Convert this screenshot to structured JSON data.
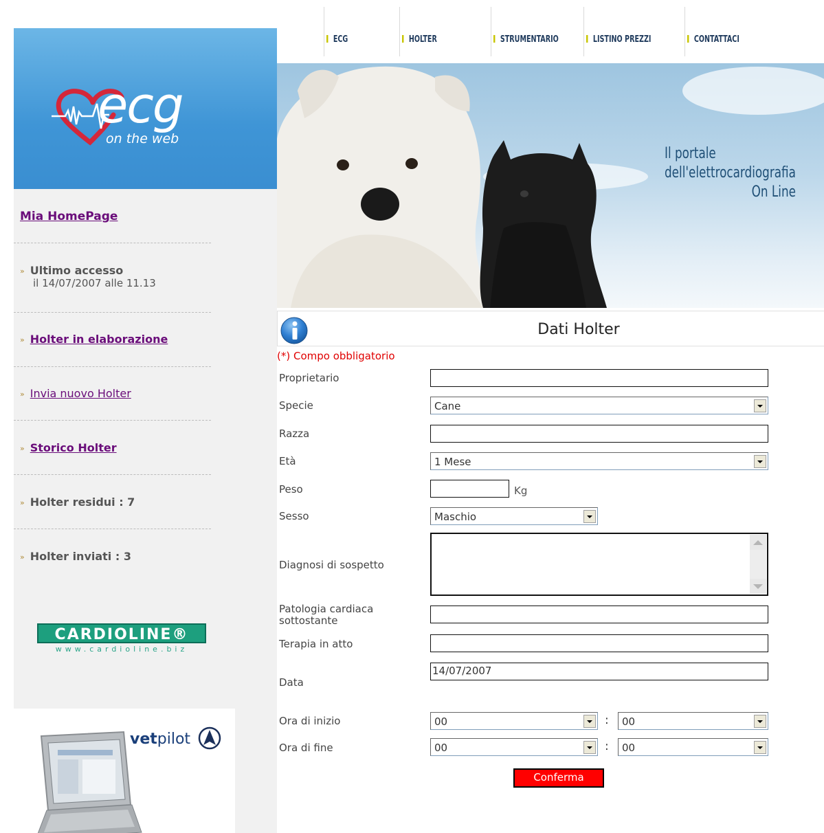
{
  "nav": {
    "items": [
      "ECG",
      "HOLTER",
      "STRUMENTARIO",
      "LISTINO PREZZI",
      "CONTATTACI"
    ]
  },
  "logo": {
    "main": "ecg",
    "sub": "on the web"
  },
  "sidebar": {
    "home_link": "Mia HomePage",
    "last_access_label": "Ultimo accesso",
    "last_access_value": "il 14/07/2007 alle 11.13",
    "holter_processing": "Holter in elaborazione",
    "send_new_holter": "Invia nuovo Holter",
    "holter_history": "Storico Holter",
    "holter_remaining": "Holter residui : 7",
    "holter_sent": "Holter inviati : 3"
  },
  "ads": {
    "cardioline_name": "CARDIOLINE®",
    "cardioline_url": "www.cardioline.biz",
    "vetpilot_brand_bold": "vet",
    "vetpilot_brand": "pilot"
  },
  "banner": {
    "line1": "Il portale",
    "line2": "dell'elettrocardiografia",
    "line3": "On Line"
  },
  "form": {
    "title": "Dati Holter",
    "required_note": "(*) Compo obbligatorio",
    "labels": {
      "owner": "Proprietario",
      "species": "Specie",
      "breed": "Razza",
      "age": "Età",
      "weight": "Peso",
      "sex": "Sesso",
      "diagnosis": "Diagnosi di sospetto",
      "pathology_l1": "Patologia cardiaca",
      "pathology_l2": "sottostante",
      "therapy": "Terapia in atto",
      "date": "Data",
      "start_time": "Ora di inizio",
      "end_time": "Ora di fine"
    },
    "values": {
      "owner": "",
      "species": "Cane",
      "breed": "",
      "age": "1 Mese",
      "weight": "",
      "weight_unit": "Kg",
      "sex": "Maschio",
      "diagnosis": "",
      "pathology": "",
      "therapy": "",
      "date": "14/07/2007",
      "start_hour": "00",
      "start_min": "00",
      "end_hour": "00",
      "end_min": "00",
      "colon": ":"
    },
    "submit": "Conferma"
  },
  "colors": {
    "accent_purple": "#6a0d7a",
    "nav_bar": "#c8c600",
    "confirm_red": "#ff0000",
    "required_red": "#e00000",
    "logo_blue": "#3f95d6"
  }
}
